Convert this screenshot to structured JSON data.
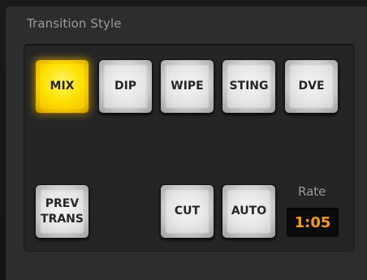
{
  "panel": {
    "title": "Transition Style"
  },
  "styles": [
    {
      "label": "MIX",
      "active": true
    },
    {
      "label": "DIP",
      "active": false
    },
    {
      "label": "WIPE",
      "active": false
    },
    {
      "label": "STING",
      "active": false
    },
    {
      "label": "DVE",
      "active": false
    }
  ],
  "controls": {
    "prev_trans_label": "PREV\nTRANS",
    "cut_label": "CUT",
    "auto_label": "AUTO",
    "rate_label": "Rate",
    "rate_value": "1:05"
  },
  "colors": {
    "active_button": "#ffdd00",
    "rate_text": "#ff9a1c",
    "panel_bg": "#2d2d2d"
  }
}
